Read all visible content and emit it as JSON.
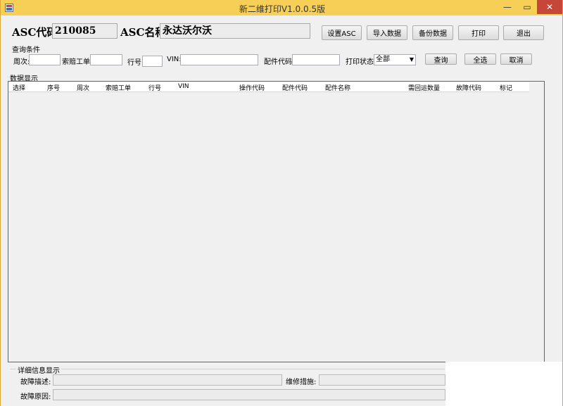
{
  "window": {
    "title": "新二维打印V1.0.0.5版",
    "controls": {
      "minimize": "—",
      "maximize": "▭",
      "close": "✕"
    }
  },
  "header": {
    "asc_code_label": "ASC代码",
    "asc_code_value": "210085",
    "asc_name_label": "ASC名称",
    "asc_name_value": "永达沃尔沃"
  },
  "toolbar": {
    "set_asc": "设置ASC",
    "import_data": "导入数据",
    "backup_data": "备份数据",
    "print": "打印",
    "exit": "退出"
  },
  "query": {
    "group_title": "查询条件",
    "week_label": "周次:",
    "claim_label": "索赔工单:",
    "line_label": "行号:",
    "vin_label": "VIN:",
    "part_code_label": "配件代码:",
    "print_status_label": "打印状态:",
    "print_status_value": "全部",
    "search_button": "查询",
    "select_all_button": "全选",
    "cancel_button": "取消"
  },
  "data_display": {
    "group_title": "数据显示",
    "columns": [
      "选择",
      "序号",
      "周次",
      "索赔工单",
      "行号",
      "VIN",
      "操作代码",
      "配件代码",
      "配件名称",
      "需回运数量",
      "故障代码",
      "标记"
    ]
  },
  "detail": {
    "group_title": "详细信息显示",
    "fault_desc_label": "故障描述:",
    "repair_measure_label": "维修措施:",
    "fault_cause_label": "故障原因:"
  }
}
